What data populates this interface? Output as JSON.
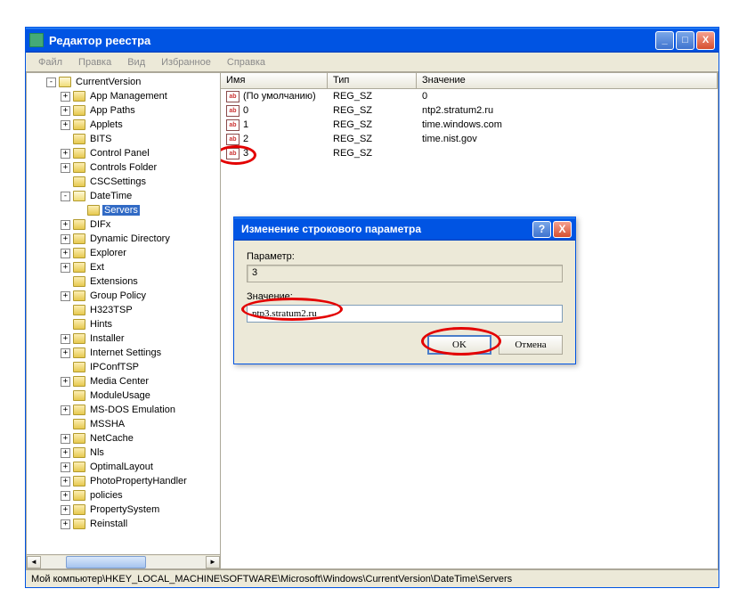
{
  "window": {
    "title": "Редактор реестра",
    "buttons": {
      "min": "_",
      "max": "□",
      "close": "X"
    }
  },
  "menu": {
    "file": "Файл",
    "edit": "Правка",
    "view": "Вид",
    "favorites": "Избранное",
    "help": "Справка"
  },
  "tree": {
    "items": [
      {
        "level": 1,
        "exp": "-",
        "label": "CurrentVersion",
        "open": true
      },
      {
        "level": 2,
        "exp": "+",
        "label": "App Management"
      },
      {
        "level": 2,
        "exp": "+",
        "label": "App Paths"
      },
      {
        "level": 2,
        "exp": "+",
        "label": "Applets"
      },
      {
        "level": 2,
        "exp": "",
        "label": "BITS"
      },
      {
        "level": 2,
        "exp": "+",
        "label": "Control Panel"
      },
      {
        "level": 2,
        "exp": "+",
        "label": "Controls Folder"
      },
      {
        "level": 2,
        "exp": "",
        "label": "CSCSettings"
      },
      {
        "level": 2,
        "exp": "-",
        "label": "DateTime",
        "open": true
      },
      {
        "level": 3,
        "exp": "",
        "label": "Servers",
        "selected": true
      },
      {
        "level": 2,
        "exp": "+",
        "label": "DIFx"
      },
      {
        "level": 2,
        "exp": "+",
        "label": "Dynamic Directory"
      },
      {
        "level": 2,
        "exp": "+",
        "label": "Explorer"
      },
      {
        "level": 2,
        "exp": "+",
        "label": "Ext"
      },
      {
        "level": 2,
        "exp": "",
        "label": "Extensions"
      },
      {
        "level": 2,
        "exp": "+",
        "label": "Group Policy"
      },
      {
        "level": 2,
        "exp": "",
        "label": "H323TSP"
      },
      {
        "level": 2,
        "exp": "",
        "label": "Hints"
      },
      {
        "level": 2,
        "exp": "+",
        "label": "Installer"
      },
      {
        "level": 2,
        "exp": "+",
        "label": "Internet Settings"
      },
      {
        "level": 2,
        "exp": "",
        "label": "IPConfTSP"
      },
      {
        "level": 2,
        "exp": "+",
        "label": "Media Center"
      },
      {
        "level": 2,
        "exp": "",
        "label": "ModuleUsage"
      },
      {
        "level": 2,
        "exp": "+",
        "label": "MS-DOS Emulation"
      },
      {
        "level": 2,
        "exp": "",
        "label": "MSSHA"
      },
      {
        "level": 2,
        "exp": "+",
        "label": "NetCache"
      },
      {
        "level": 2,
        "exp": "+",
        "label": "Nls"
      },
      {
        "level": 2,
        "exp": "+",
        "label": "OptimalLayout"
      },
      {
        "level": 2,
        "exp": "+",
        "label": "PhotoPropertyHandler"
      },
      {
        "level": 2,
        "exp": "+",
        "label": "policies"
      },
      {
        "level": 2,
        "exp": "+",
        "label": "PropertySystem"
      },
      {
        "level": 2,
        "exp": "+",
        "label": "Reinstall"
      }
    ]
  },
  "list": {
    "headers": {
      "name": "Имя",
      "type": "Тип",
      "value": "Значение"
    },
    "rows": [
      {
        "name": "(По умолчанию)",
        "type": "REG_SZ",
        "value": "0"
      },
      {
        "name": "0",
        "type": "REG_SZ",
        "value": "ntp2.stratum2.ru"
      },
      {
        "name": "1",
        "type": "REG_SZ",
        "value": "time.windows.com"
      },
      {
        "name": "2",
        "type": "REG_SZ",
        "value": "time.nist.gov"
      },
      {
        "name": "3",
        "type": "REG_SZ",
        "value": "",
        "highlight": true
      }
    ]
  },
  "dialog": {
    "title": "Изменение строкового параметра",
    "help": "?",
    "close": "X",
    "param_label": "Параметр:",
    "param_value": "3",
    "value_label": "Значение:",
    "value_input": "ntp3.stratum2.ru",
    "ok": "OK",
    "cancel": "Отмена"
  },
  "statusbar": "Мой компьютер\\HKEY_LOCAL_MACHINE\\SOFTWARE\\Microsoft\\Windows\\CurrentVersion\\DateTime\\Servers"
}
